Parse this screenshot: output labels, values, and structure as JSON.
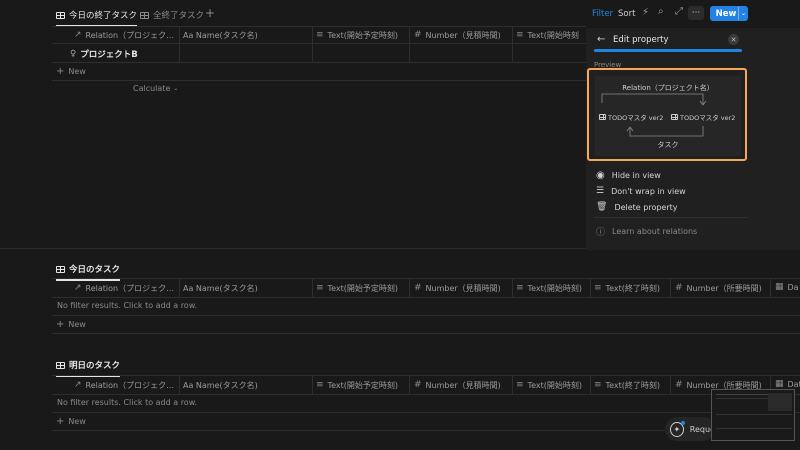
{
  "top_tabs": [
    {
      "label": "今日の終了タスク",
      "active": true
    },
    {
      "label": "全終了タスク",
      "active": false
    }
  ],
  "add_tab_icon": "plus-icon",
  "toolbar": {
    "filter": "Filter",
    "sort": "Sort",
    "new": "New",
    "accent": "#2383e2"
  },
  "section1": {
    "columns": [
      "Relation（プロジェク…",
      "Aa Name(タスク名)",
      "Text(開始予定時刻)",
      "Number（見積時間)",
      "Text(開始時刻"
    ],
    "row1_relation": "プロジェクトB",
    "new_label": "New",
    "calculate": "Calculate"
  },
  "panel": {
    "title": "Edit property",
    "preview_label": "Preview",
    "relation_label": "Relation（プロジェクト名）",
    "left_db": "TODOマスタ ver2",
    "right_db": "TODOマスタ ver2",
    "bottom_label": "タスク",
    "hide": "Hide in view",
    "wrap": "Don't wrap in view",
    "delete": "Delete property",
    "learn": "Learn about relations",
    "highlight_color": "#f5a85a"
  },
  "section2": {
    "title": "今日のタスク",
    "columns": [
      "Relation（プロジェク…",
      "Aa Name(タスク名)",
      "Text(開始予定時刻)",
      "Number（見積時間)",
      "Text(開始時刻)",
      "Text(終了時刻)",
      "Number（所要時間)",
      "Da"
    ],
    "empty": "No filter results. Click to add a row.",
    "new_label": "New"
  },
  "section3": {
    "title": "明日のタスク",
    "columns": [
      "Relation（プロジェク…",
      "Aa Name(タスク名)",
      "Text(開始予定時刻)",
      "Number（見積時間)",
      "Text(開始時刻)",
      "Text(終了時刻)",
      "Number（所要時間)",
      "Dat"
    ],
    "empty": "No filter results. Click to add a row.",
    "new_label": "New"
  },
  "request_button": "Reque"
}
